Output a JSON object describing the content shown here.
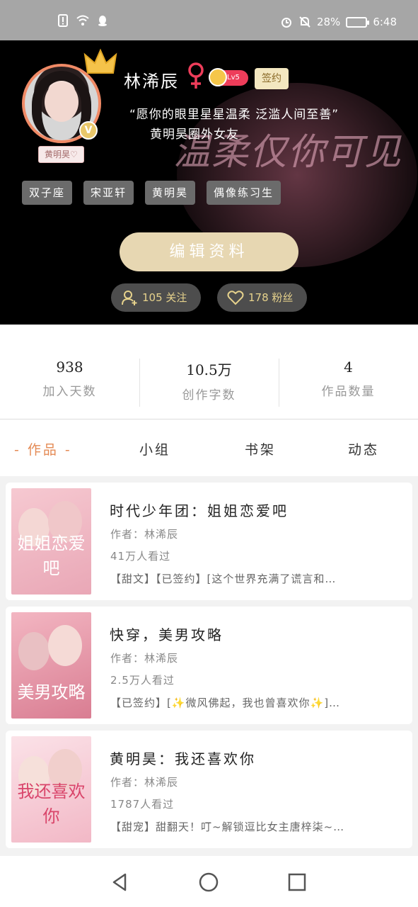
{
  "status_bar": {
    "battery": "28%",
    "time": "6:48"
  },
  "profile": {
    "avatar_tag": "黄明昊♡",
    "username": "林浠辰",
    "gender_symbol": "♀",
    "level": "Lv5",
    "signed_badge": "签约",
    "motto_line1": "“愿你的眼里星星温柔 泛滥人间至善”",
    "motto_line2": "黄明昊圈外女友",
    "background_text": "温柔仅你可见",
    "tags": [
      "双子座",
      "宋亚轩",
      "黄明昊",
      "偶像练习生"
    ],
    "edit_button": "编辑资料",
    "following": "105 关注",
    "followers": "178 粉丝"
  },
  "stats": [
    {
      "value": "938",
      "label": "加入天数"
    },
    {
      "value": "10.5万",
      "label": "创作字数"
    },
    {
      "value": "4",
      "label": "作品数量"
    }
  ],
  "tabs": [
    "- 作品 -",
    "小组",
    "书架",
    "动态"
  ],
  "works": [
    {
      "title": "时代少年团：姐姐恋爱吧",
      "author": "作者：林浠辰",
      "views": "41万人看过",
      "desc": "【甜文】【已签约】[这个世界充满了谎言和…",
      "cover_text": "姐姐恋爱吧",
      "cover_colors": [
        "#f6c9d1",
        "#e9a7b6"
      ]
    },
    {
      "title": "快穿，美男攻略",
      "author": "作者：林浠辰",
      "views": "2.5万人看过",
      "desc": "【已签约】[✨微风佛起，我也曾喜欢你✨]…",
      "cover_text": "美男攻略",
      "cover_colors": [
        "#f3b6c2",
        "#d97d92"
      ]
    },
    {
      "title": "黄明昊：我还喜欢你",
      "author": "作者：林浠辰",
      "views": "1787人看过",
      "desc": "【甜宠】甜翻天！叮~解锁逗比女主唐梓柒~…",
      "cover_text": "我还喜欢你",
      "cover_colors": [
        "#fbe2e8",
        "#f2b8c6"
      ]
    }
  ],
  "colors": {
    "accent": "#e48a54",
    "edit_button_bg": "#e7d7b2",
    "level_red": "#ee3d5a",
    "pill_text": "#e6d28c"
  }
}
